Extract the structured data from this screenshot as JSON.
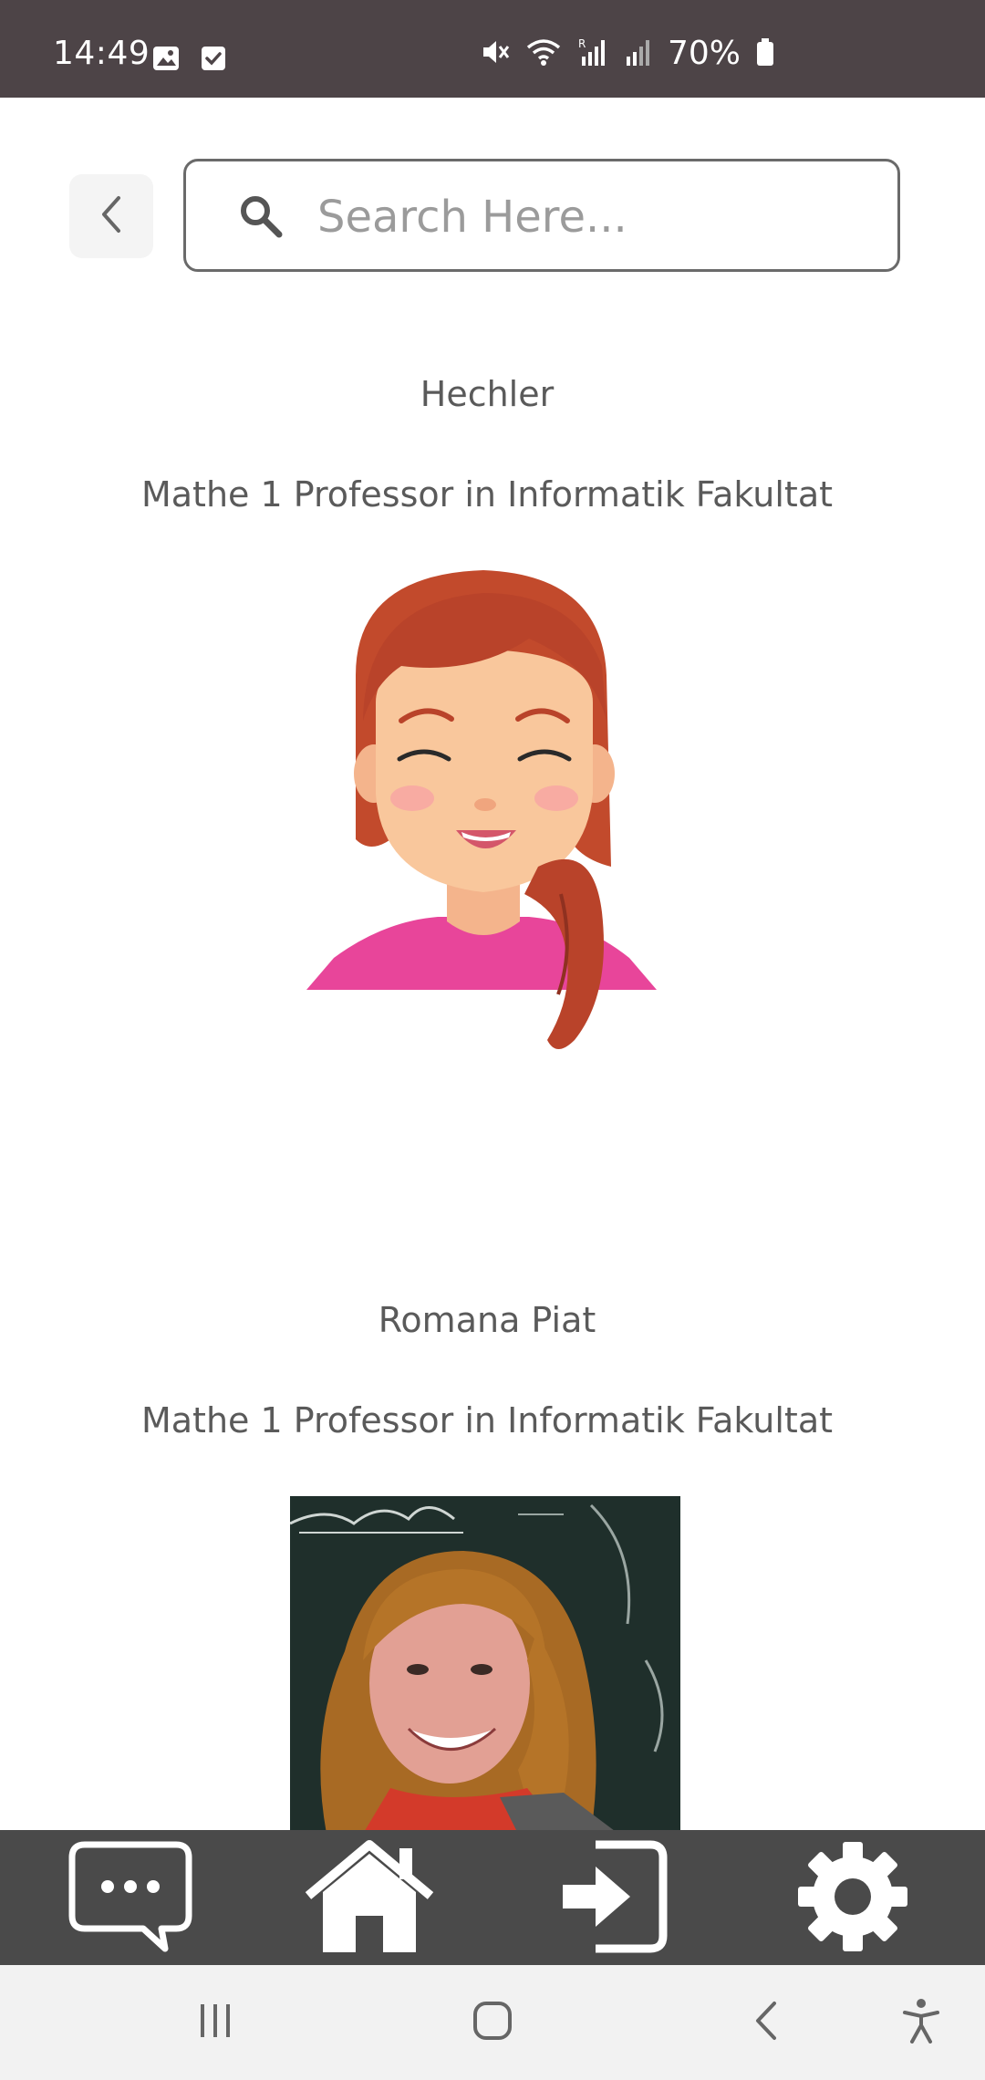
{
  "status_bar": {
    "time": "14:49",
    "battery_percent": "70%",
    "icons": [
      "image-icon",
      "checkbox-icon",
      "mute-icon",
      "wifi-icon",
      "signal-icon",
      "signal-icon-2",
      "battery-icon"
    ]
  },
  "header": {
    "back_icon": "chevron-left-icon",
    "search_placeholder": "Search Here..."
  },
  "professors": [
    {
      "name": "Hechler",
      "role": "Mathe 1 Professor in Informatik Fakultat",
      "image": "avatar-cartoon-woman"
    },
    {
      "name": "Romana Piat",
      "role": "Mathe 1 Professor in Informatik Fakultat",
      "image": "photo-woman"
    }
  ],
  "tab_bar": {
    "items": [
      {
        "icon": "chat-icon"
      },
      {
        "icon": "home-icon"
      },
      {
        "icon": "login-icon"
      },
      {
        "icon": "gear-icon"
      }
    ]
  },
  "system_nav": {
    "items": [
      "recents-icon",
      "home-circle-icon",
      "back-icon",
      "accessibility-icon"
    ]
  }
}
